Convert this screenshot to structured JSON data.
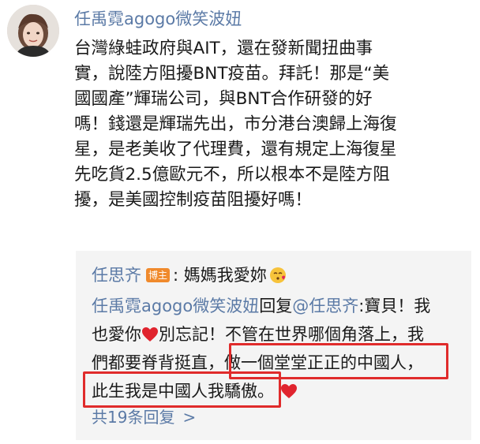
{
  "comment": {
    "author": "任禹霓agogo微笑波妞",
    "avatar_icon": "avatar-photo",
    "lines": [
      "台灣綠蛙政府與AIT，還在發新聞扭曲事",
      "實，說陸方阻擾BNT疫苗。拜託！那是“美",
      "國國產”輝瑞公司，與BNT合作研發的好",
      "嗎！錢還是輝瑞先出，市分港台澳歸上海復",
      "星，是老美收了代理費，還有規定上海復星",
      "先吃貨2.5億歐元不，所以根本不是陸方阻",
      "擾，是美國控制疫苗阻擾好嗎！"
    ]
  },
  "replies": {
    "first": {
      "author": "任思齐",
      "badge": "博主",
      "text": ": 媽媽我愛妳",
      "emoji": "kissing-heart-emoji"
    },
    "second": {
      "author": "任禹霓agogo微笑波妞",
      "reply_word": "回复",
      "mention": "@任思齐",
      "line1_rest": ":寶貝！我",
      "line2_a": "也愛你",
      "line2_b": "別忘記！不管在世界哪個角落上，我",
      "line3_a": "們都要脊背挺直，",
      "line3_b": "做一個堂堂正正的中國人，",
      "line4": "此生我是中國人我驕傲。",
      "heart_icon": "red-heart-icon"
    },
    "more": "共19条回复",
    "more_chevron": ">"
  },
  "colors": {
    "link_blue": "#5b7aa6",
    "highlight_red": "#e02b2b",
    "badge_orange": "#f08a2c",
    "reply_bg": "#f4f4f4"
  }
}
